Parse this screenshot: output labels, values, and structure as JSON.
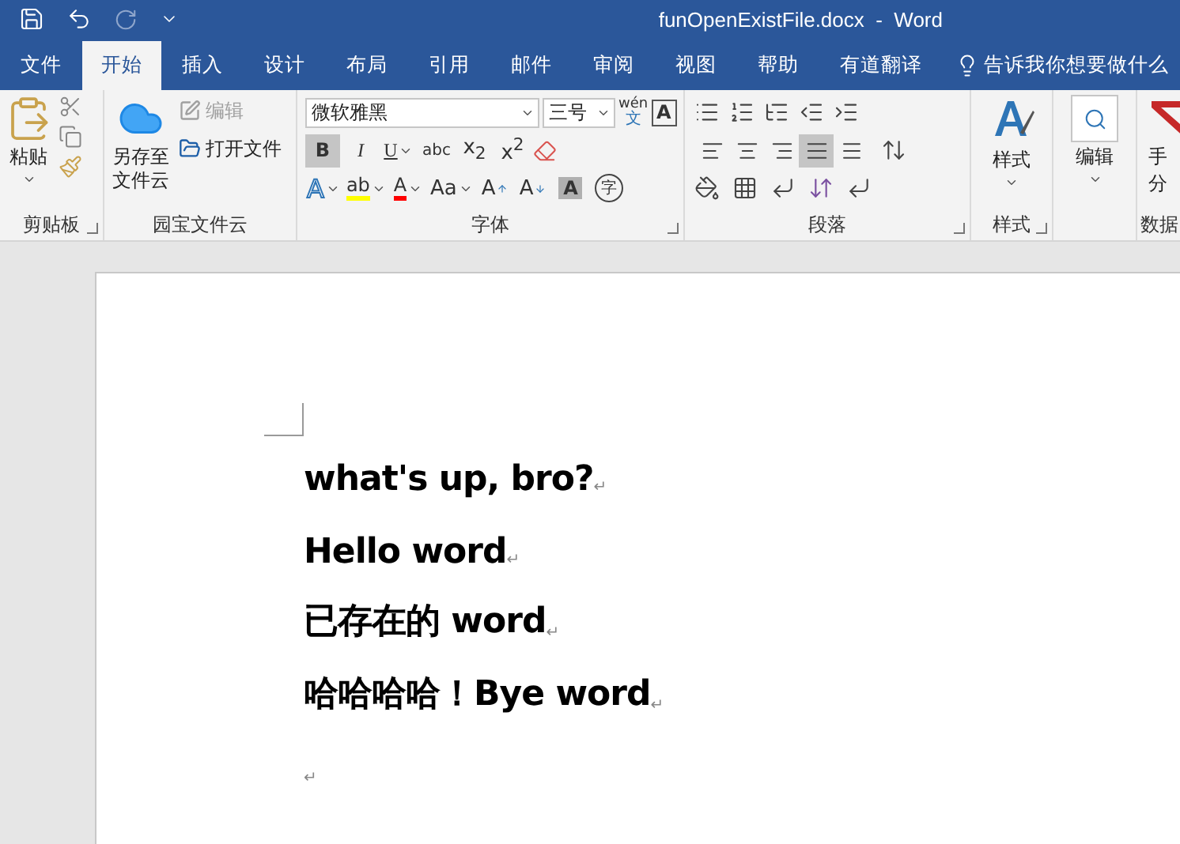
{
  "window": {
    "title": "funOpenExistFile.docx  -  Word"
  },
  "tabs": [
    {
      "label": "文件",
      "selected": false
    },
    {
      "label": "开始",
      "selected": true
    },
    {
      "label": "插入",
      "selected": false
    },
    {
      "label": "设计",
      "selected": false
    },
    {
      "label": "布局",
      "selected": false
    },
    {
      "label": "引用",
      "selected": false
    },
    {
      "label": "邮件",
      "selected": false
    },
    {
      "label": "审阅",
      "selected": false
    },
    {
      "label": "视图",
      "selected": false
    },
    {
      "label": "帮助",
      "selected": false
    },
    {
      "label": "有道翻译",
      "selected": false
    }
  ],
  "tell_me": "告诉我你想要做什么",
  "ribbon": {
    "clipboard": {
      "paste": "粘贴",
      "label": "剪贴板"
    },
    "cloud": {
      "save": "另存至文件云",
      "edit": {
        "label": "编辑",
        "disabled": true
      },
      "open": "打开文件",
      "label": "园宝文件云"
    },
    "font": {
      "name": "微软雅黑",
      "size": "三号",
      "phonetic": {
        "label": "wén",
        "base": "文"
      },
      "border_char": "A",
      "row1": [
        {
          "label": "B",
          "kind": "bold",
          "selected": true,
          "dropdown": false
        },
        {
          "label": "I",
          "kind": "italic",
          "selected": false,
          "dropdown": false
        },
        {
          "label": "U",
          "kind": "underline",
          "selected": false,
          "dropdown": true
        },
        {
          "label": "abc",
          "kind": "strike",
          "selected": false,
          "dropdown": false
        },
        {
          "label": "x$_{2}$",
          "kind": "plain",
          "selected": false,
          "dropdown": false
        },
        {
          "label": "x$^{2}$",
          "kind": "plain",
          "selected": false,
          "dropdown": false
        }
      ],
      "row2": [
        {
          "label": "A",
          "kind": "effect",
          "dropdown": true
        },
        {
          "label": "ab",
          "kind": "highlight",
          "color": "#ffff00",
          "dropdown": true
        },
        {
          "label": "A",
          "kind": "fontcolor",
          "color": "#ff0000",
          "dropdown": true
        },
        {
          "label": "Aa",
          "kind": "plain",
          "dropdown": true
        },
        {
          "label": "A",
          "kind": "grow",
          "dropdown": false
        },
        {
          "label": "A",
          "kind": "shrink",
          "dropdown": false
        },
        {
          "label": "A",
          "kind": "shade",
          "dropdown": false
        },
        {
          "label": "字",
          "kind": "circle",
          "dropdown": false
        }
      ],
      "label": "字体"
    },
    "paragraph": {
      "alignments": [
        {
          "kind": "left",
          "selected": false
        },
        {
          "kind": "center",
          "selected": false
        },
        {
          "kind": "right",
          "selected": false
        },
        {
          "kind": "justify",
          "selected": true
        },
        {
          "kind": "distributed",
          "selected": false
        }
      ],
      "label": "段落"
    },
    "styles": {
      "button": "样式",
      "label": "样式"
    },
    "editing": {
      "button": "编辑"
    },
    "data": {
      "button_lines": [
        "手",
        "分"
      ],
      "label": "数据"
    }
  },
  "document": {
    "paragraphs": [
      {
        "text": "what's up, bro?",
        "mark": "↵"
      },
      {
        "text": "Hello word",
        "mark": "↵"
      },
      {
        "text": "已存在的 word",
        "mark": "↵"
      },
      {
        "text": "哈哈哈哈！Bye word",
        "mark": "↵"
      },
      {
        "mark": "↵"
      }
    ]
  }
}
